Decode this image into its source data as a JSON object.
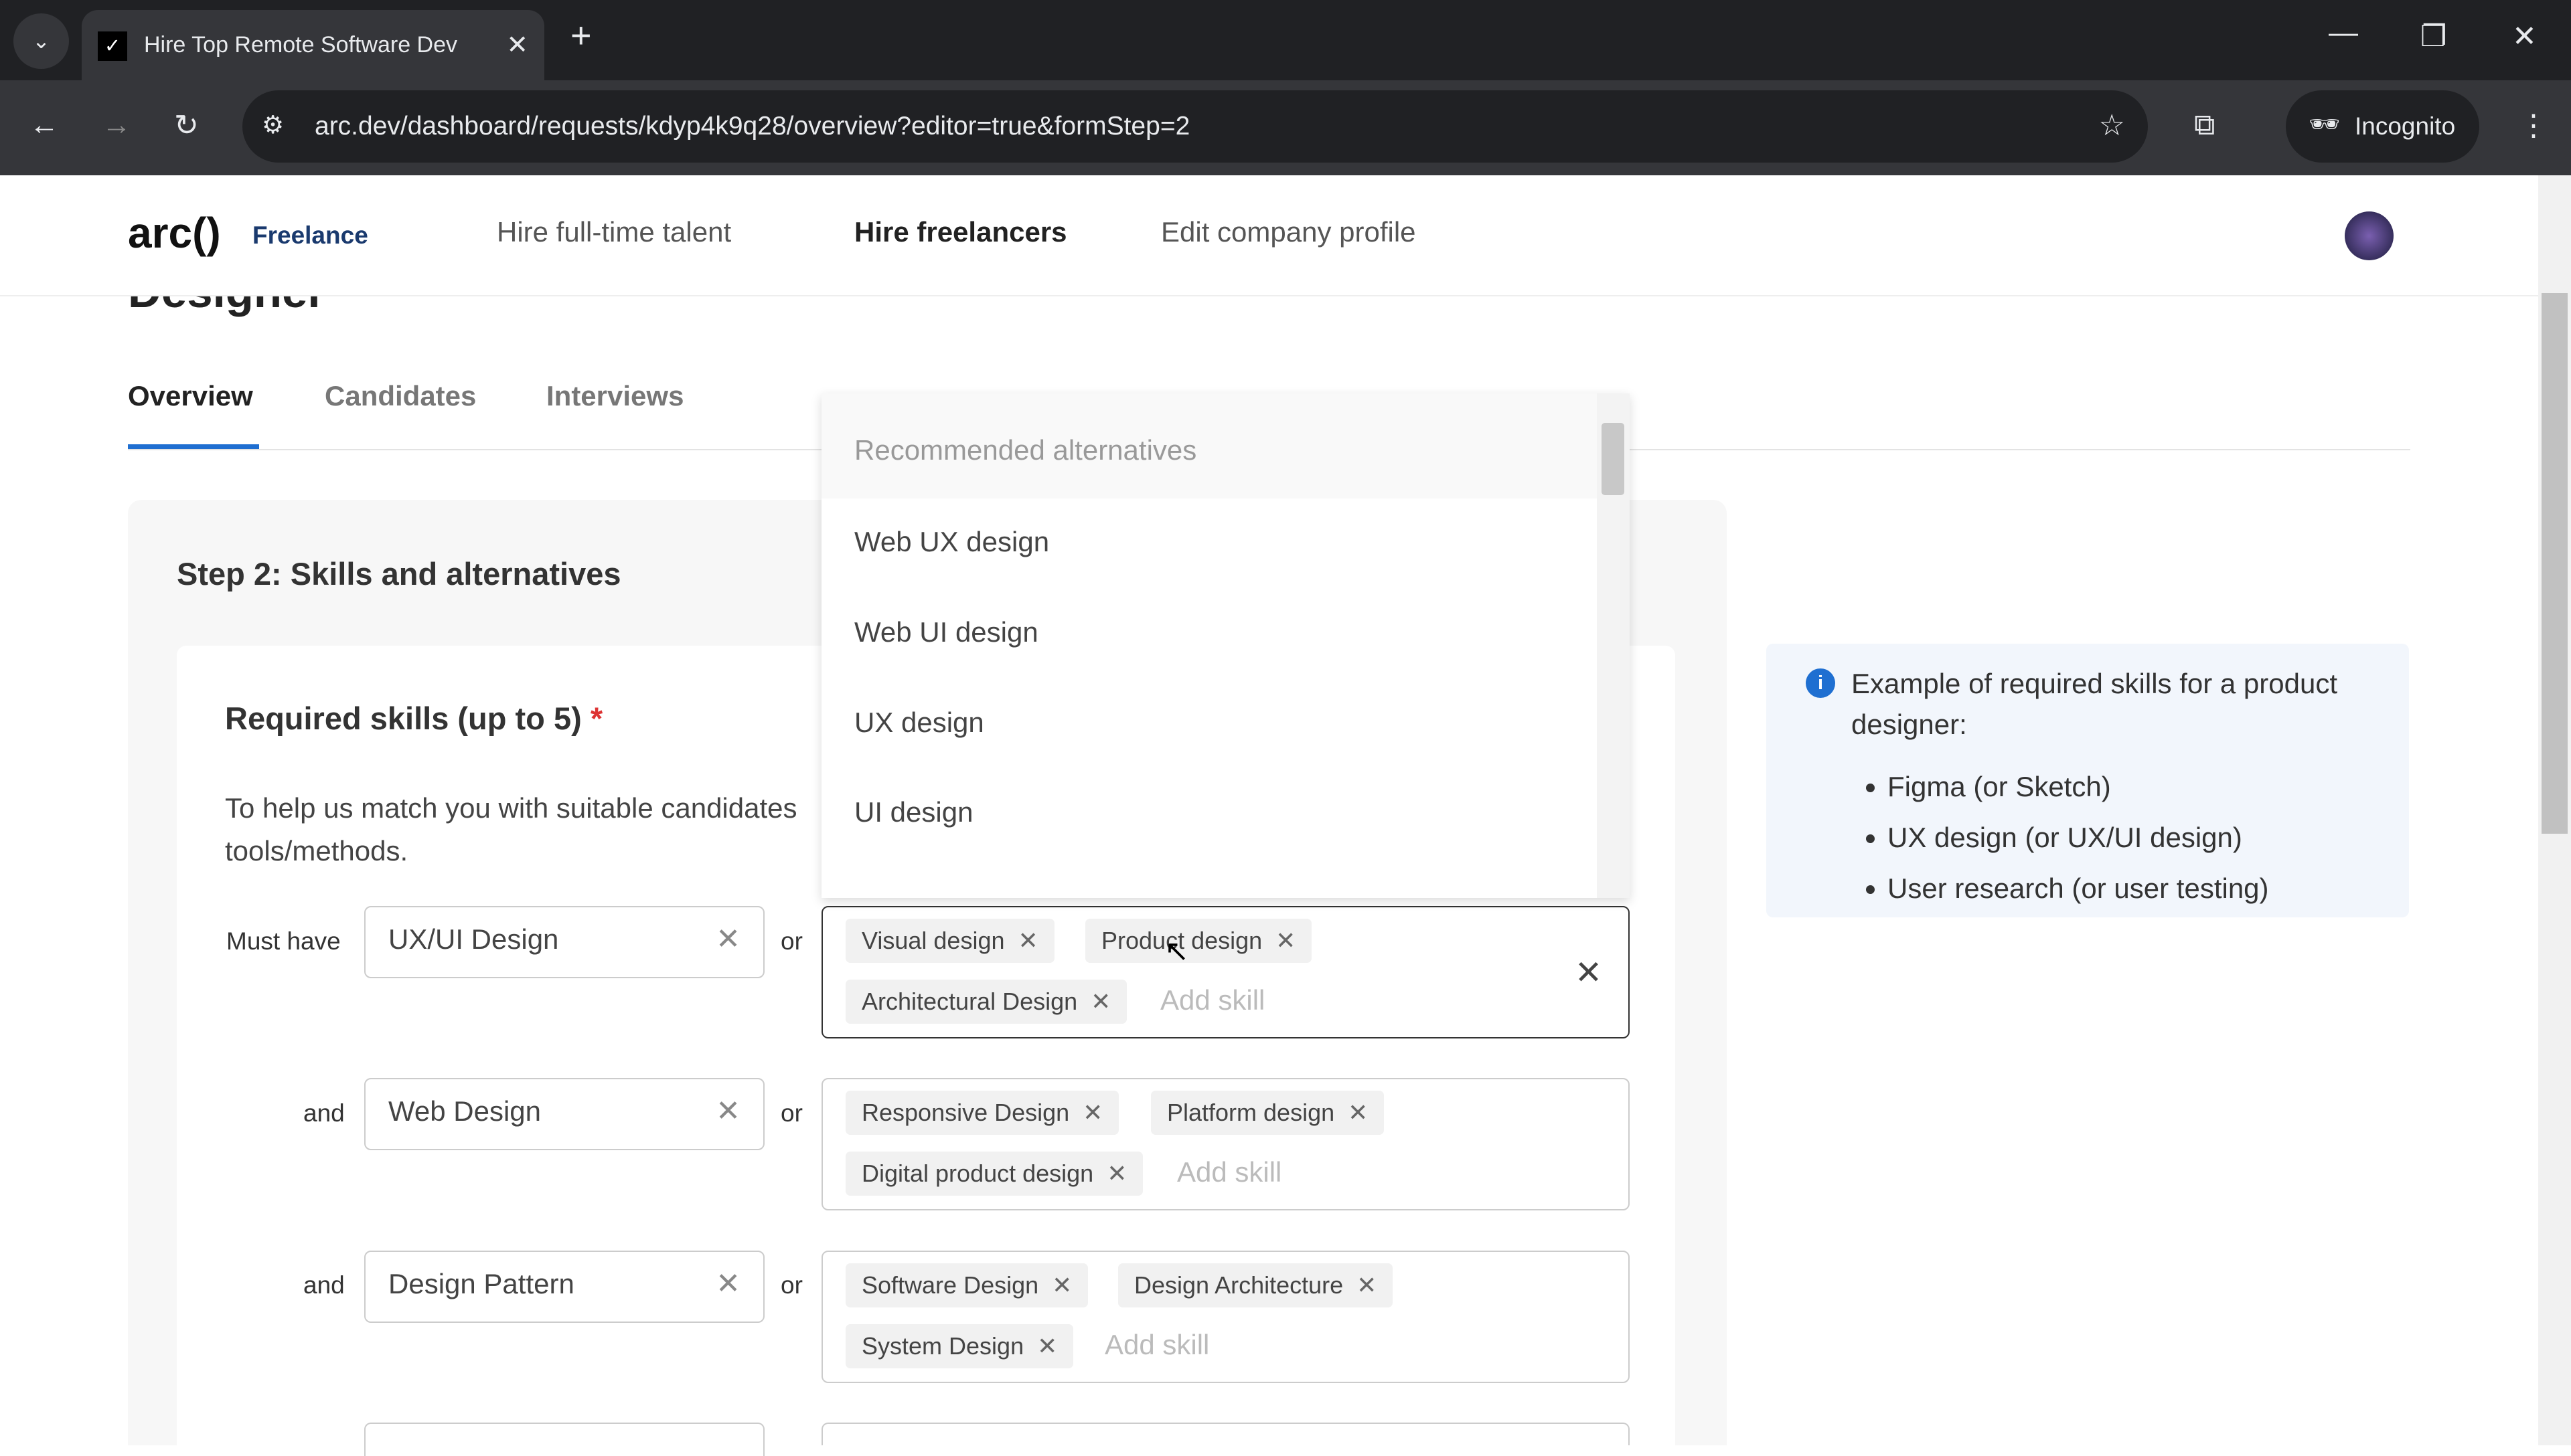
{
  "browser": {
    "tab_title": "Hire Top Remote Software Dev",
    "url": "arc.dev/dashboard/requests/kdyp4k9q28/overview?editor=true&formStep=2",
    "profile": "Incognito"
  },
  "nav": {
    "logo": "arc()",
    "logo_sub": "Freelance",
    "links": [
      "Hire full-time talent",
      "Hire freelancers",
      "Edit company profile"
    ]
  },
  "page": {
    "title_partial": "Designer",
    "tabs": [
      "Overview",
      "Candidates",
      "Interviews"
    ],
    "step_title": "Step 2: Skills and alternatives",
    "section_title": "Required skills (up to 5)",
    "required_mark": "*",
    "description": "To help us match you with suitable candidates",
    "description2": "tools/methods."
  },
  "skills": [
    {
      "prefix": "Must have",
      "value": "UX/UI Design",
      "or": "or",
      "alternatives": [
        "Visual design",
        "Product design",
        "Architectural Design"
      ],
      "add_placeholder": "Add skill"
    },
    {
      "prefix": "and",
      "value": "Web Design",
      "or": "or",
      "alternatives": [
        "Responsive Design",
        "Platform design",
        "Digital product design"
      ],
      "add_placeholder": "Add skill"
    },
    {
      "prefix": "and",
      "value": "Design Pattern",
      "or": "or",
      "alternatives": [
        "Software Design",
        "Design Architecture",
        "System Design"
      ],
      "add_placeholder": "Add skill"
    }
  ],
  "dropdown": {
    "header": "Recommended alternatives",
    "options": [
      "Web UX design",
      "Web UI design",
      "UX design",
      "UI design"
    ]
  },
  "info": {
    "text": "Example of required skills for a product designer:",
    "items": [
      "Figma (or Sketch)",
      "UX design (or UX/UI design)",
      "User research (or user testing)"
    ]
  },
  "colors": {
    "accent": "#1f6fd1",
    "required": "#d33"
  }
}
